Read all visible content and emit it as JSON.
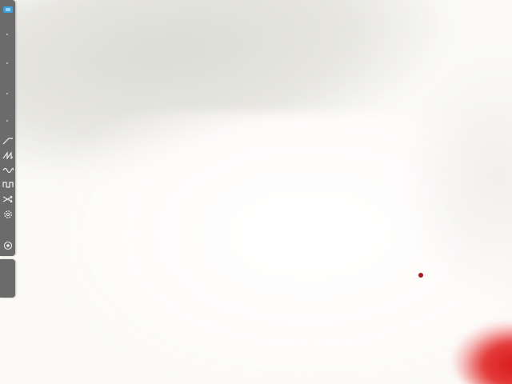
{
  "colors": {
    "toolbar_bg": "#6b6b6b",
    "toolbar_icon": "#eeeeee",
    "accent_active": "#3aa0e0",
    "red_marker": "#b01818"
  },
  "toolbar": {
    "tools": [
      {
        "icon": "active-tool-icon",
        "active": true
      },
      {
        "icon": "ramp-wave-icon"
      },
      {
        "icon": "sawtooth-wave-icon"
      },
      {
        "icon": "sine-wave-icon"
      },
      {
        "icon": "square-wave-icon"
      },
      {
        "icon": "shuffle-icon"
      },
      {
        "icon": "settings-icon"
      },
      {
        "icon": "record-icon"
      }
    ]
  }
}
